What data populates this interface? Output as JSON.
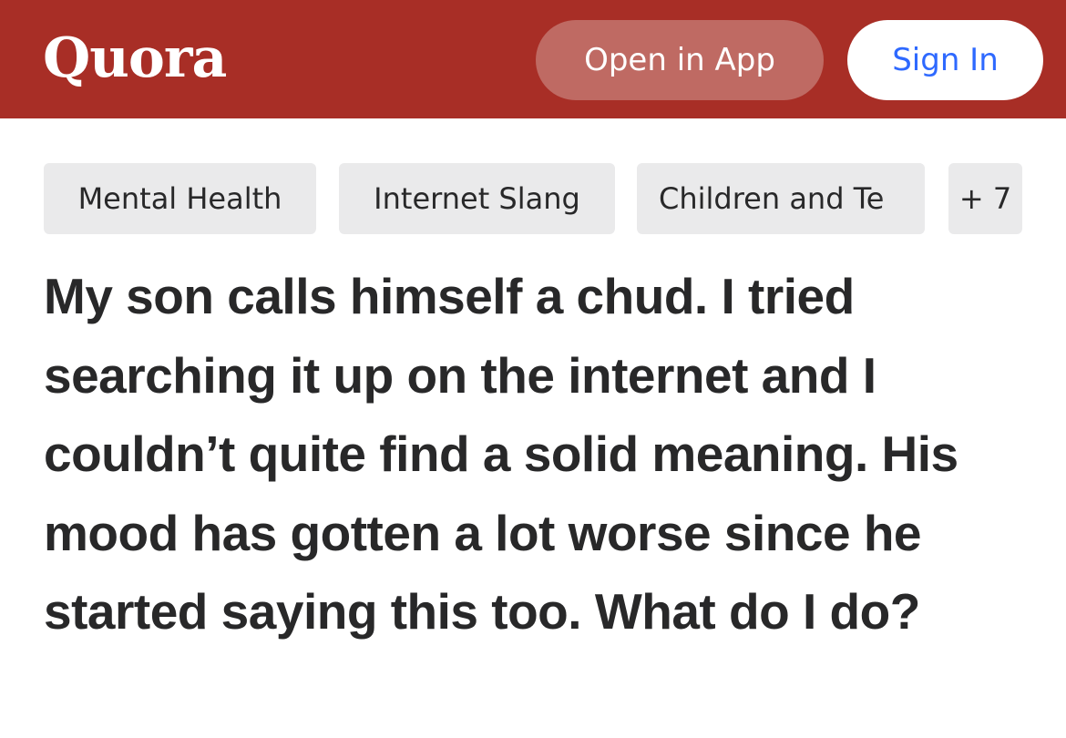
{
  "header": {
    "logo": "Quora",
    "open_in_app_label": "Open in App",
    "sign_in_label": "Sign In"
  },
  "topics": [
    {
      "label": "Mental Health"
    },
    {
      "label": "Internet Slang"
    },
    {
      "label": "Children and Te"
    },
    {
      "label": "+ 7"
    }
  ],
  "question": {
    "title": "My son calls himself a chud. I tried searching it up on the internet and I couldn’t quite find a solid meaning. His mood has gotten a lot worse since he started saying this too. What do I do?"
  },
  "colors": {
    "header_bg": "#a82e26",
    "open_in_app_bg": "#bf6a63",
    "sign_in_text": "#2e69ff",
    "topic_bg": "#eaeaeb",
    "text": "#282829"
  }
}
